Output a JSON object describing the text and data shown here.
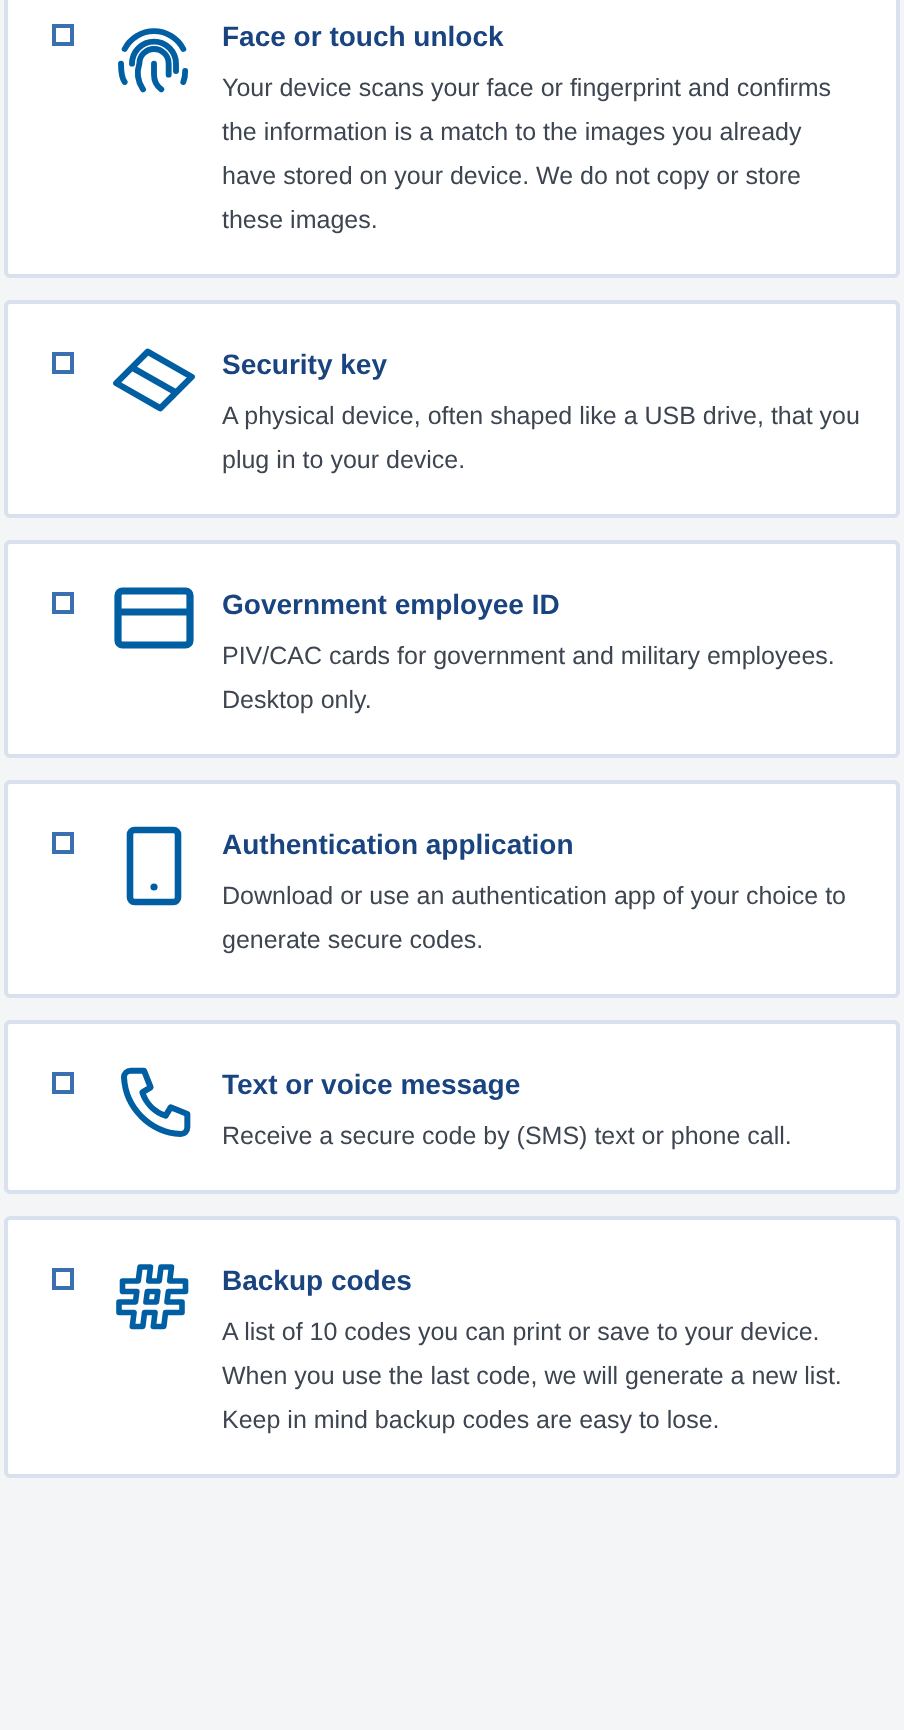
{
  "options": [
    {
      "kind": "fingerprint",
      "checked": false,
      "title": "Face or touch unlock",
      "description": "Your device scans your face or fingerprint and confirms the information is a match to the images you already have stored on your device. We do not copy or store these images."
    },
    {
      "kind": "key",
      "checked": false,
      "title": "Security key",
      "description": "A physical device, often shaped like a USB drive, that you plug in to your device."
    },
    {
      "kind": "card",
      "checked": false,
      "title": "Government employee ID",
      "description": "PIV/CAC cards for government and military employees. Desktop only."
    },
    {
      "kind": "tablet",
      "checked": false,
      "title": "Authentication application",
      "description": "Download or use an authentication app of your choice to generate secure codes."
    },
    {
      "kind": "phone",
      "checked": false,
      "title": "Text or voice message",
      "description": "Receive a secure code by (SMS) text or phone call."
    },
    {
      "kind": "hash",
      "checked": false,
      "title": "Backup codes",
      "description": "A list of 10 codes you can print or save to your device. When you use the last code, we will generate a new list. Keep in mind backup codes are easy to lose."
    }
  ]
}
